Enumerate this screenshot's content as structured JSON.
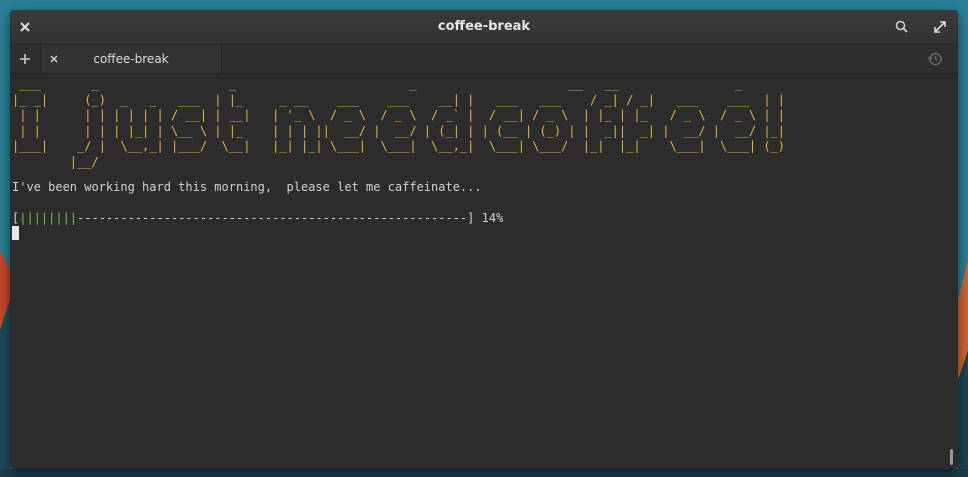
{
  "window": {
    "title": "coffee-break"
  },
  "tabs": [
    {
      "label": "coffee-break"
    }
  ],
  "icons": {
    "close": "close-icon",
    "search": "search-icon",
    "fullscreen": "fullscreen-icon",
    "new_tab": "plus-icon",
    "tab_close": "close-icon",
    "history": "history-icon"
  },
  "terminal": {
    "ascii_banner": " ___       _                  _                        _                     __   __                _ \n|_ _|     (_)  _   _   ___  | |_     _ __    ___    ___    __| |   ___   ___    / _| / _|   ___    ___  | |\n | |      | | | | | | / __| | __|   | '_ \\  / _ \\  / _ \\  / _` |  / __| / _ \\  | |_ | |_   / _ \\  / _ \\ | |\n | |      | | | |_| | \\__ \\ | |_    | | | ||  __/ |  __/ | (_| | | (__ | (_) | |  _||  _| |  __/ |  __/ |_|\n|___|    _/ |  \\__,_| |___/  \\__|   |_| |_| \\___|  \\___|  \\__,_|  \\___| \\___/  |_|  |_|    \\___|  \\___| (_)\n        |__/",
    "message": "I've been working hard this morning,  please let me caffeinate...",
    "progress_open": "[",
    "progress_fill": "||||||||",
    "progress_rest": "------------------------------------------------------]",
    "progress_percent": "14%",
    "progress_value": 0.14
  },
  "colors": {
    "banner": "#e2b43a",
    "progress_fill": "#6fbf4a",
    "terminal_bg": "#2c2c2c"
  }
}
